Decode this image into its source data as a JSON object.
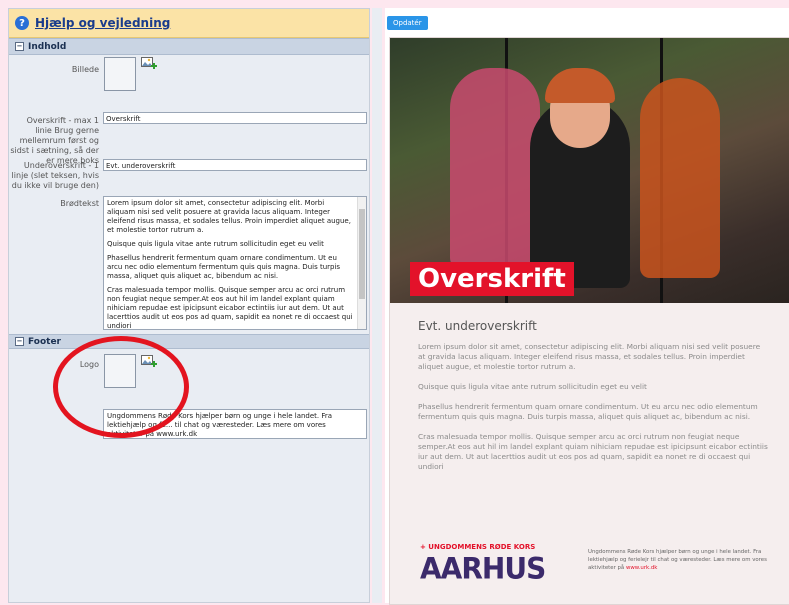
{
  "left": {
    "help_title": "Hjælp og vejledning",
    "sections": {
      "content": "Indhold",
      "footer": "Footer"
    },
    "labels": {
      "image": "Billede",
      "heading": "Overskrift - max 1 linie Brug gerne mellemrum først og sidst i sætning, så der er mere boks",
      "subheading": "Underoverskrift - 1 linje (slet teksen, hvis du ikke vil bruge den)",
      "body": "Brødtekst",
      "logo": "Logo"
    },
    "fields": {
      "heading": "Overskrift",
      "subheading": "Evt. underoverskrift",
      "body_paragraphs": [
        "Lorem ipsum dolor sit amet, consectetur adipiscing elit. Morbi aliquam nisi sed velit posuere at gravida lacus aliquam. Integer eleifend risus massa, et sodales tellus. Proin imperdiet aliquet augue, et molestie tortor rutrum a.",
        "Quisque quis ligula vitae ante rutrum sollicitudin eget eu velit",
        "Phasellus hendrerit fermentum quam ornare condimentum. Ut eu arcu nec odio elementum fermentum quis quis magna. Duis turpis massa, aliquet quis aliquet ac, bibendum ac nisi.",
        "Cras malesuada tempor mollis. Quisque semper arcu ac orci rutrum non feugiat neque semper.At eos aut hil im landel explant quiam nihiciam repudae est ipicipsunt eicabor ectintiis iur aut dem. Ut aut lacerttios audit ut eos pos ad quam, sapidit ea nonet re di occaest qui undiori"
      ],
      "footer_text": "Ungdommens Røde Kors hjælper børn og unge i hele landet. Fra lektiehjælp og fe... til chat og væresteder. Læs mere om vores aktiviteter på www.urk.dk"
    }
  },
  "preview": {
    "update_button": "Opdatér",
    "headline": "Overskrift",
    "subheading": "Evt. underoverskrift",
    "body_paragraphs": [
      "Lorem ipsum dolor sit amet, consectetur adipiscing elit. Morbi aliquam nisi sed velit posuere at gravida lacus aliquam. Integer eleifend risus massa, et sodales tellus. Proin imperdiet aliquet augue, et molestie tortor rutrum a.",
      "Quisque quis ligula vitae ante rutrum sollicitudin eget eu velit",
      "Phasellus hendrerit fermentum quam ornare condimentum. Ut eu arcu nec odio elementum fermentum quis quis magna. Duis turpis massa, aliquet quis aliquet ac, bibendum ac nisi.",
      "Cras malesuada tempor mollis. Quisque semper arcu ac orci rutrum non feugiat neque semper.At eos aut hil im landel explant quiam nihiciam repudae est ipicipsunt eicabor ectintiis iur aut dem. Ut aut lacerttios audit ut eos pos ad quam, sapidit ea nonet re di occaest qui undiori"
    ],
    "logo_line1": "+ UNGDOMMENS RØDE KORS",
    "logo_line2": "AARHUS",
    "footer_text": "Ungdommens Røde Kors hjælper børn og unge i hele landet. Fra lektiehjælp og ferielejr til chat og væresteder. Læs mere om vores aktiviteter på",
    "footer_link": "www.urk.dk"
  },
  "colors": {
    "brand_red": "#e3122a",
    "brand_purple": "#3b2a6b",
    "button_blue": "#2a95e8"
  }
}
